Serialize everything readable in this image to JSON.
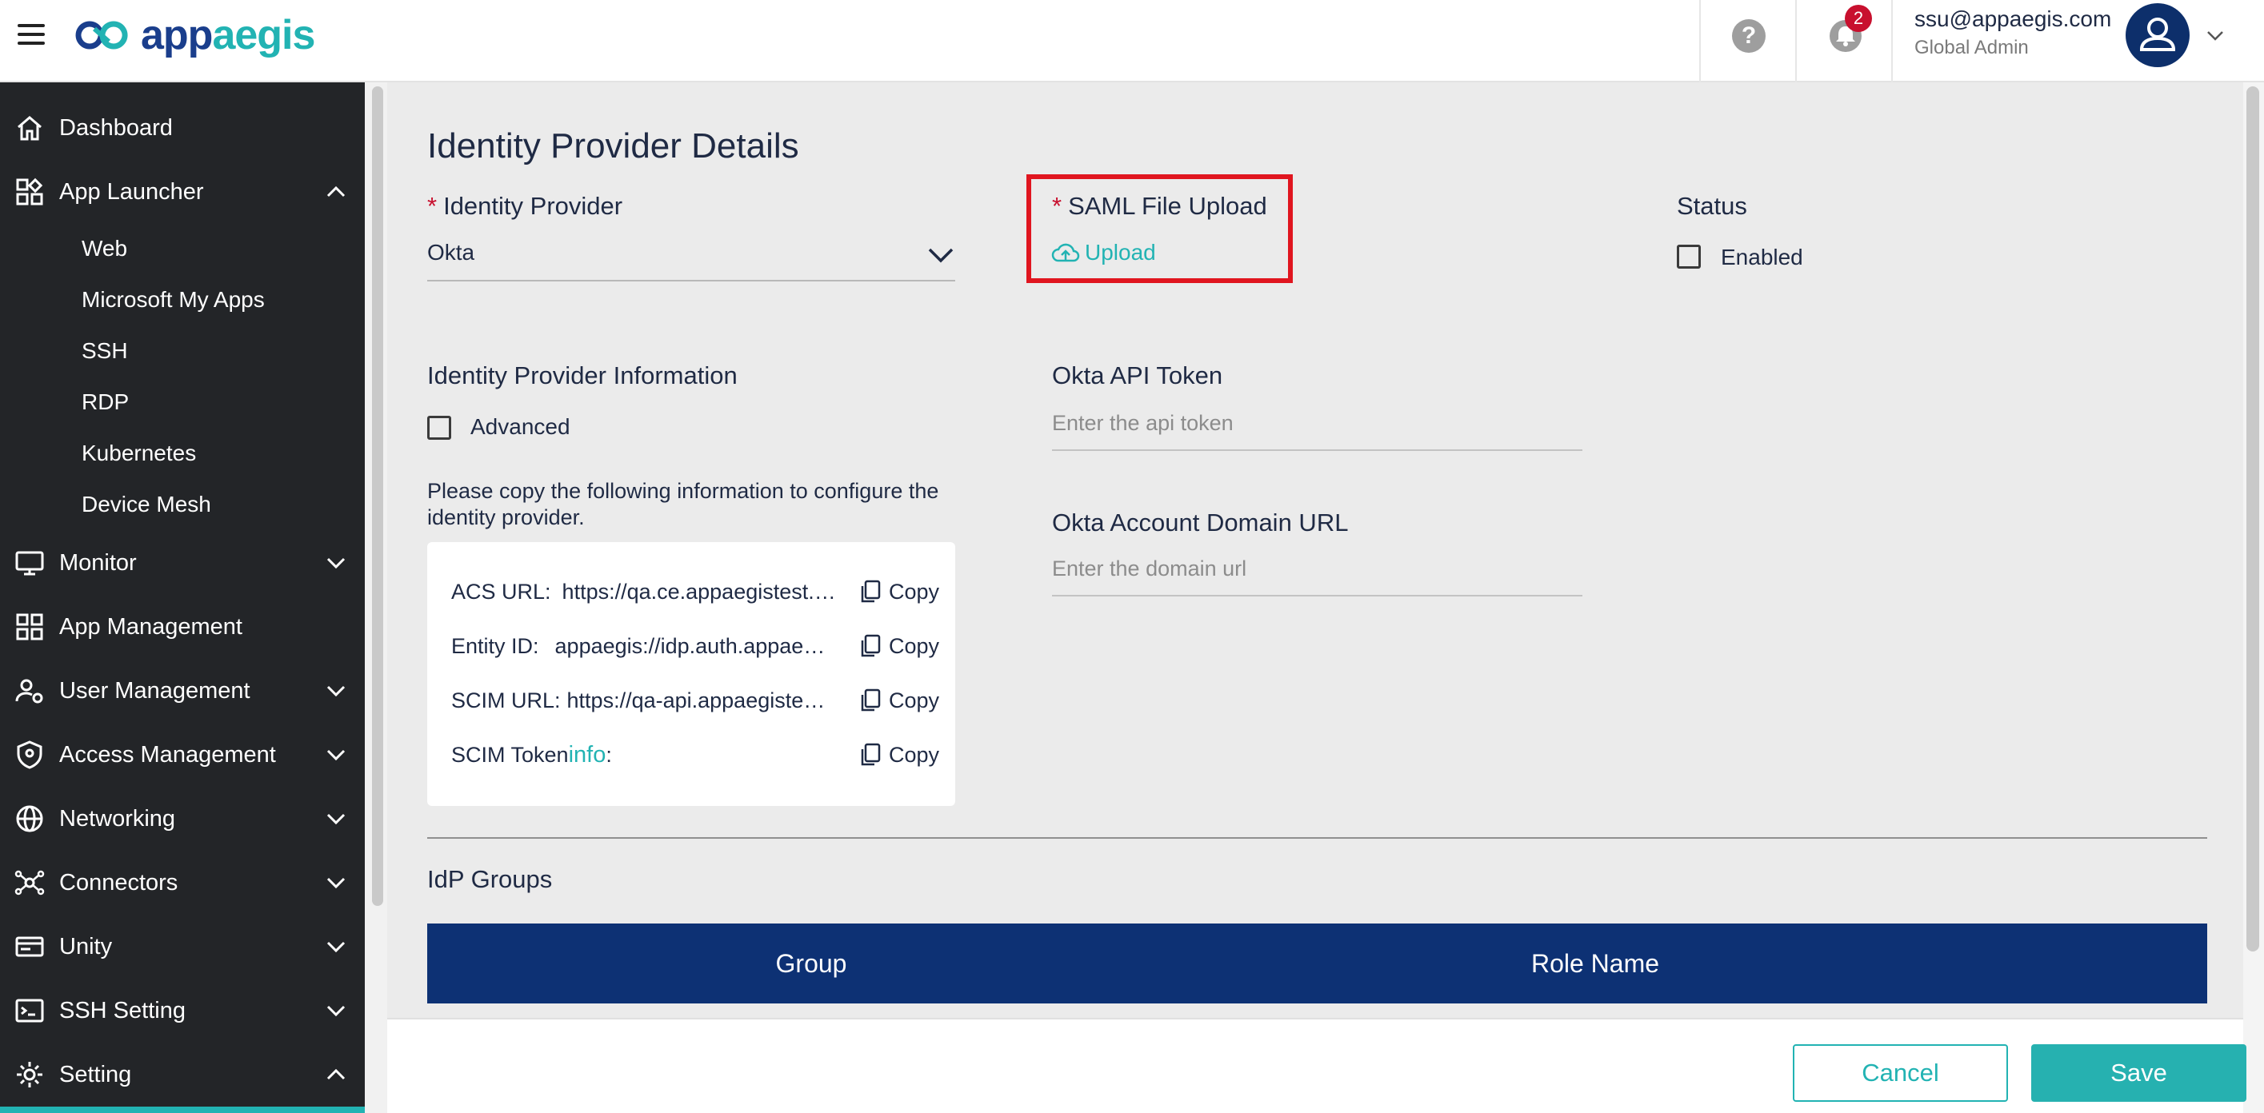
{
  "header": {
    "logo_part1": "app",
    "logo_part2": "aegis",
    "notification_count": "2",
    "user_email": "ssu@appaegis.com",
    "user_role": "Global Admin",
    "brand_colors": {
      "navy": "#1a3e8c",
      "teal": "#22b3b3"
    }
  },
  "sidebar": {
    "dashboard": "Dashboard",
    "app_launcher": "App Launcher",
    "app_launcher_items": [
      "Web",
      "Microsoft My Apps",
      "SSH",
      "RDP",
      "Kubernetes",
      "Device Mesh"
    ],
    "monitor": "Monitor",
    "app_management": "App Management",
    "user_management": "User Management",
    "access_management": "Access Management",
    "networking": "Networking",
    "connectors": "Connectors",
    "unity": "Unity",
    "ssh_setting": "SSH Setting",
    "setting": "Setting"
  },
  "main": {
    "page_title": "Identity Provider Details",
    "idp_label": "Identity Provider",
    "idp_value": "Okta",
    "saml_label": "SAML File Upload",
    "upload_label": "Upload",
    "status_label": "Status",
    "enabled_label": "Enabled",
    "idp_info_label": "Identity Provider Information",
    "advanced_label": "Advanced",
    "help_text": "Please copy the following information to configure the identity provider.",
    "info_rows": [
      {
        "key": "ACS URL:",
        "value": "https://qa.ce.appaegistest.com/saml/acs"
      },
      {
        "key": "Entity ID:",
        "value": "appaegis://idp.auth.appaegistest.com"
      },
      {
        "key": "SCIM URL:",
        "value": "https://qa-api.appaegistest.com/scim"
      },
      {
        "key": "SCIM Token",
        "info": "info",
        "suffix": ":"
      }
    ],
    "copy_label": "Copy",
    "okta_token_label": "Okta API Token",
    "okta_token_placeholder": "Enter the api token",
    "okta_domain_label": "Okta Account Domain URL",
    "okta_domain_placeholder": "Enter the domain url",
    "idp_groups_label": "IdP Groups",
    "table_columns": [
      "Group",
      "Role Name"
    ]
  },
  "footer": {
    "cancel_label": "Cancel",
    "save_label": "Save"
  }
}
